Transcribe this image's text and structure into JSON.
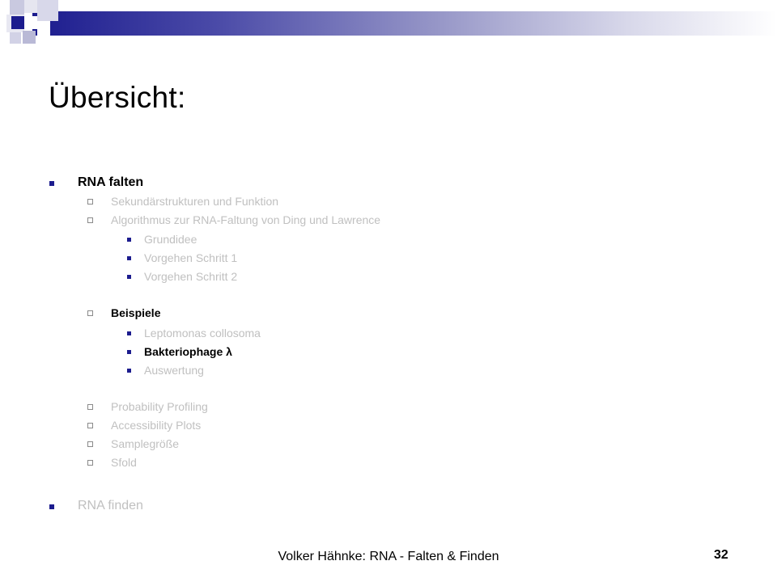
{
  "slide": {
    "title": "Übersicht:",
    "footer": "Volker Hähnke: RNA - Falten & Finden",
    "page_number": "32"
  },
  "outline": {
    "item_rna_falten": "RNA falten",
    "sub_sekundaer": "Sekundärstrukturen und Funktion",
    "sub_algorithmus": "Algorithmus zur RNA-Faltung von Ding und Lawrence",
    "algo_grundidee": "Grundidee",
    "algo_schritt1": "Vorgehen Schritt 1",
    "algo_schritt2": "Vorgehen Schritt 2",
    "sub_beispiele": "Beispiele",
    "bsp_lepto": "Leptomonas collosoma",
    "bsp_bakterio": "Bakteriophage λ",
    "bsp_auswertung": "Auswertung",
    "sub_probability": "Probability Profiling",
    "sub_accessibility": "Accessibility Plots",
    "sub_samplegroesse": "Samplegröße",
    "sub_sfold": "Sfold",
    "item_rna_finden": "RNA finden"
  },
  "colors": {
    "accent": "#1c1c8e",
    "inactive_text": "#c0c0c0",
    "active_text": "#000000"
  }
}
